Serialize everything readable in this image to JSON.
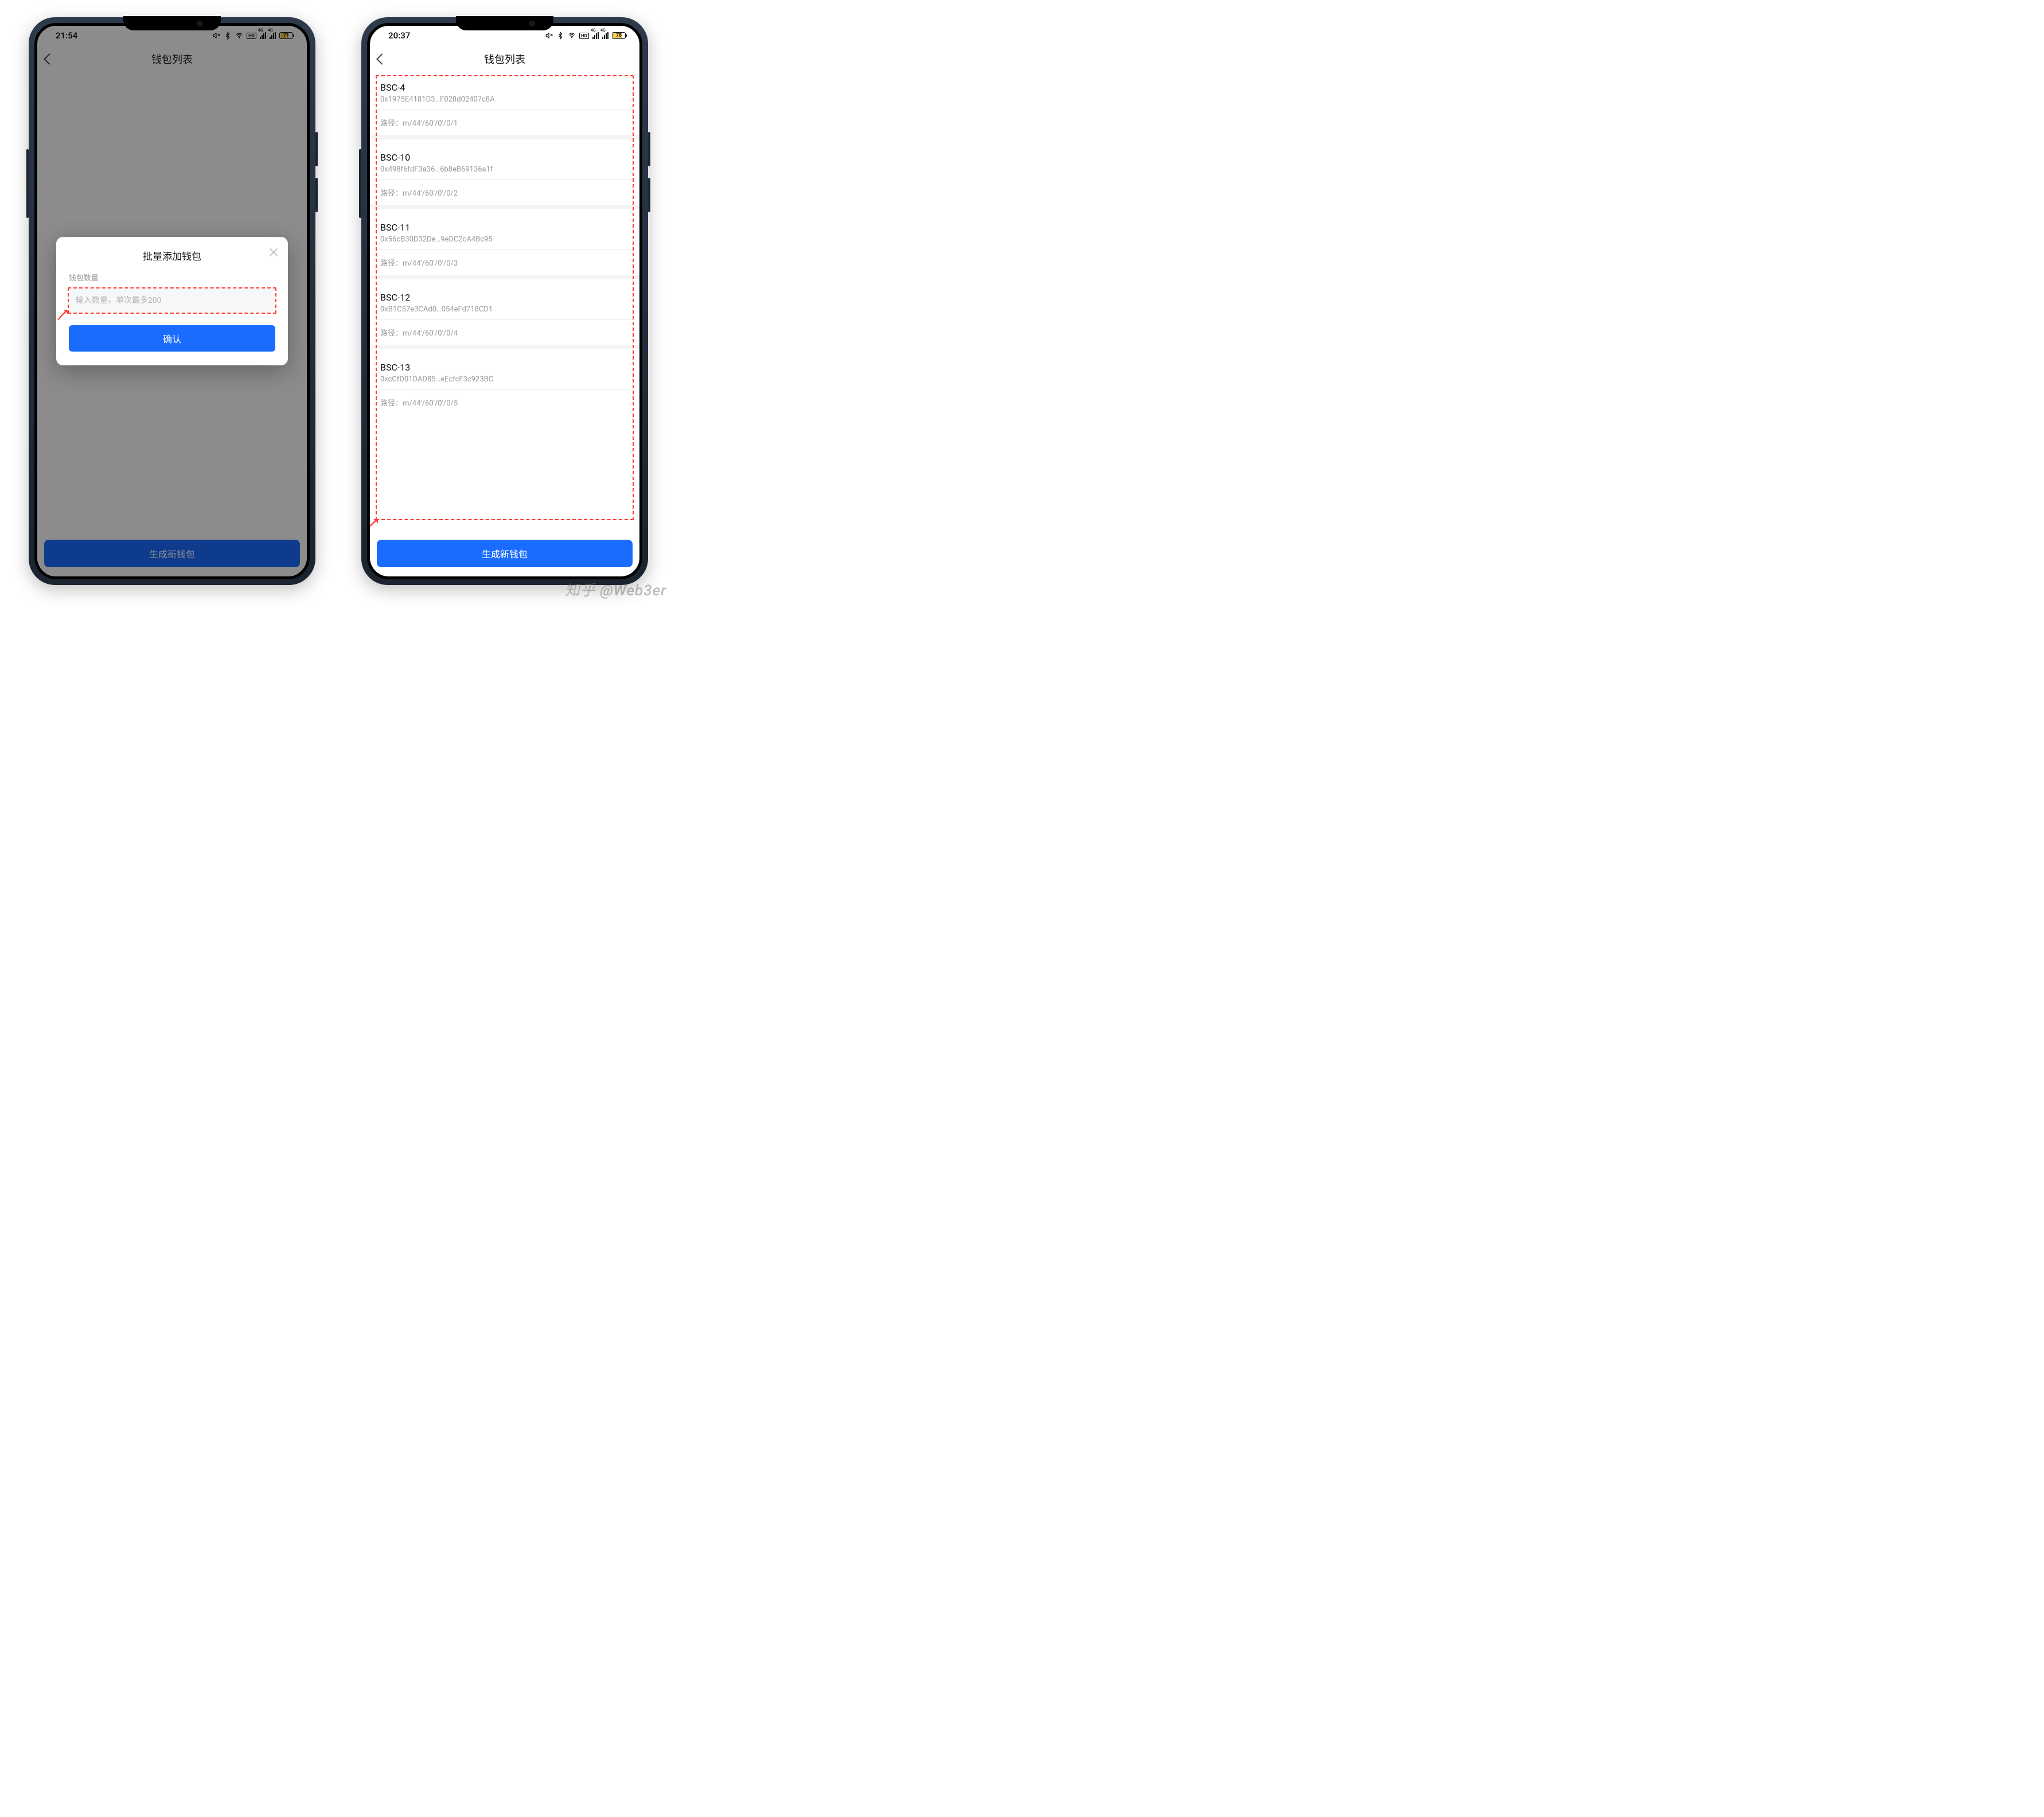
{
  "watermark": "知乎 @Web3er",
  "phoneA": {
    "status": {
      "time": "21:54",
      "battery_pct": 71
    },
    "header": {
      "title": "钱包列表"
    },
    "bottom_button": "生成新钱包",
    "modal": {
      "title": "批量添加钱包",
      "field_label": "钱包数量",
      "input_placeholder": "输入数量，单次最多200",
      "confirm_label": "确认"
    }
  },
  "phoneB": {
    "status": {
      "time": "20:37",
      "battery_pct": 78
    },
    "header": {
      "title": "钱包列表"
    },
    "bottom_button": "生成新钱包",
    "path_label_prefix": "路径：",
    "wallets": [
      {
        "name": "BSC-4",
        "address": "0x1975E4181D3…F028d02407c8A",
        "path": "m/44'/60'/0'/0/1"
      },
      {
        "name": "BSC-10",
        "address": "0x498f6fdF3a36…6b8eB69136a1f",
        "path": "m/44'/60'/0'/0/2"
      },
      {
        "name": "BSC-11",
        "address": "0x56cB30D32De…9eDC2cA4Bc95",
        "path": "m/44'/60'/0'/0/3"
      },
      {
        "name": "BSC-12",
        "address": "0xB1C57e3CAd0…054eFd718CD1",
        "path": "m/44'/60'/0'/0/4"
      },
      {
        "name": "BSC-13",
        "address": "0xcCfD01DAD85…eEcfcF3c923BC",
        "path": "m/44'/60'/0'/0/5"
      }
    ]
  }
}
